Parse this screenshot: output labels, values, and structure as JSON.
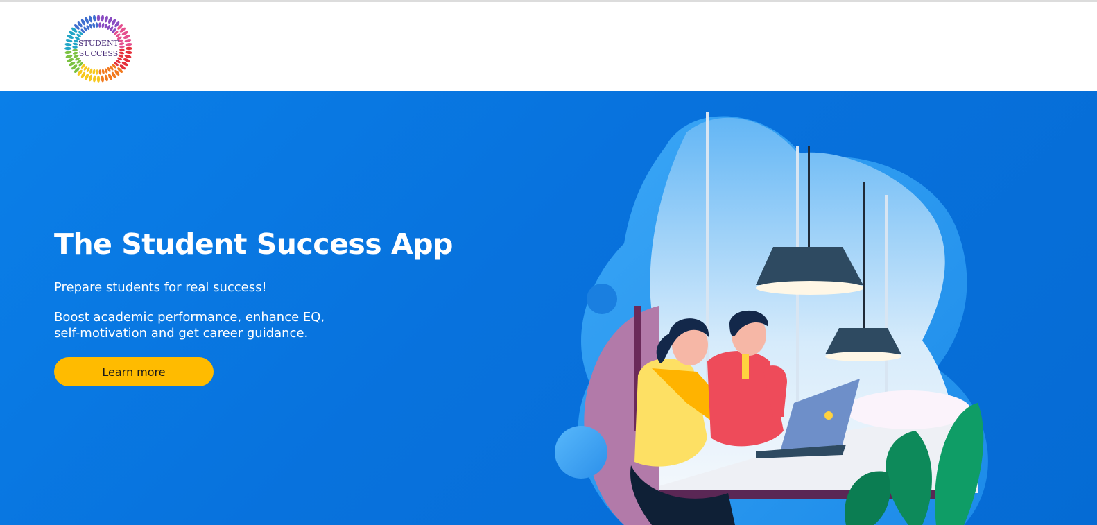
{
  "brand": {
    "logo_line1": "STUDENT",
    "logo_line2": "SUCCESS"
  },
  "hero": {
    "title": "The Student Success App",
    "tagline": "Prepare students for real success!",
    "description": "Boost academic performance, enhance EQ, self-motivation and get career guidance.",
    "cta_label": "Learn more"
  },
  "colors": {
    "hero_background": "#0872dd",
    "cta_background": "#ffbb00",
    "cta_text": "#1a1a1a",
    "heading_text": "#ffffff",
    "logo_text": "#4b2f7a"
  },
  "icons": {
    "logo": "sunburst-logo-icon",
    "illustration": "students-with-laptop-illustration"
  }
}
